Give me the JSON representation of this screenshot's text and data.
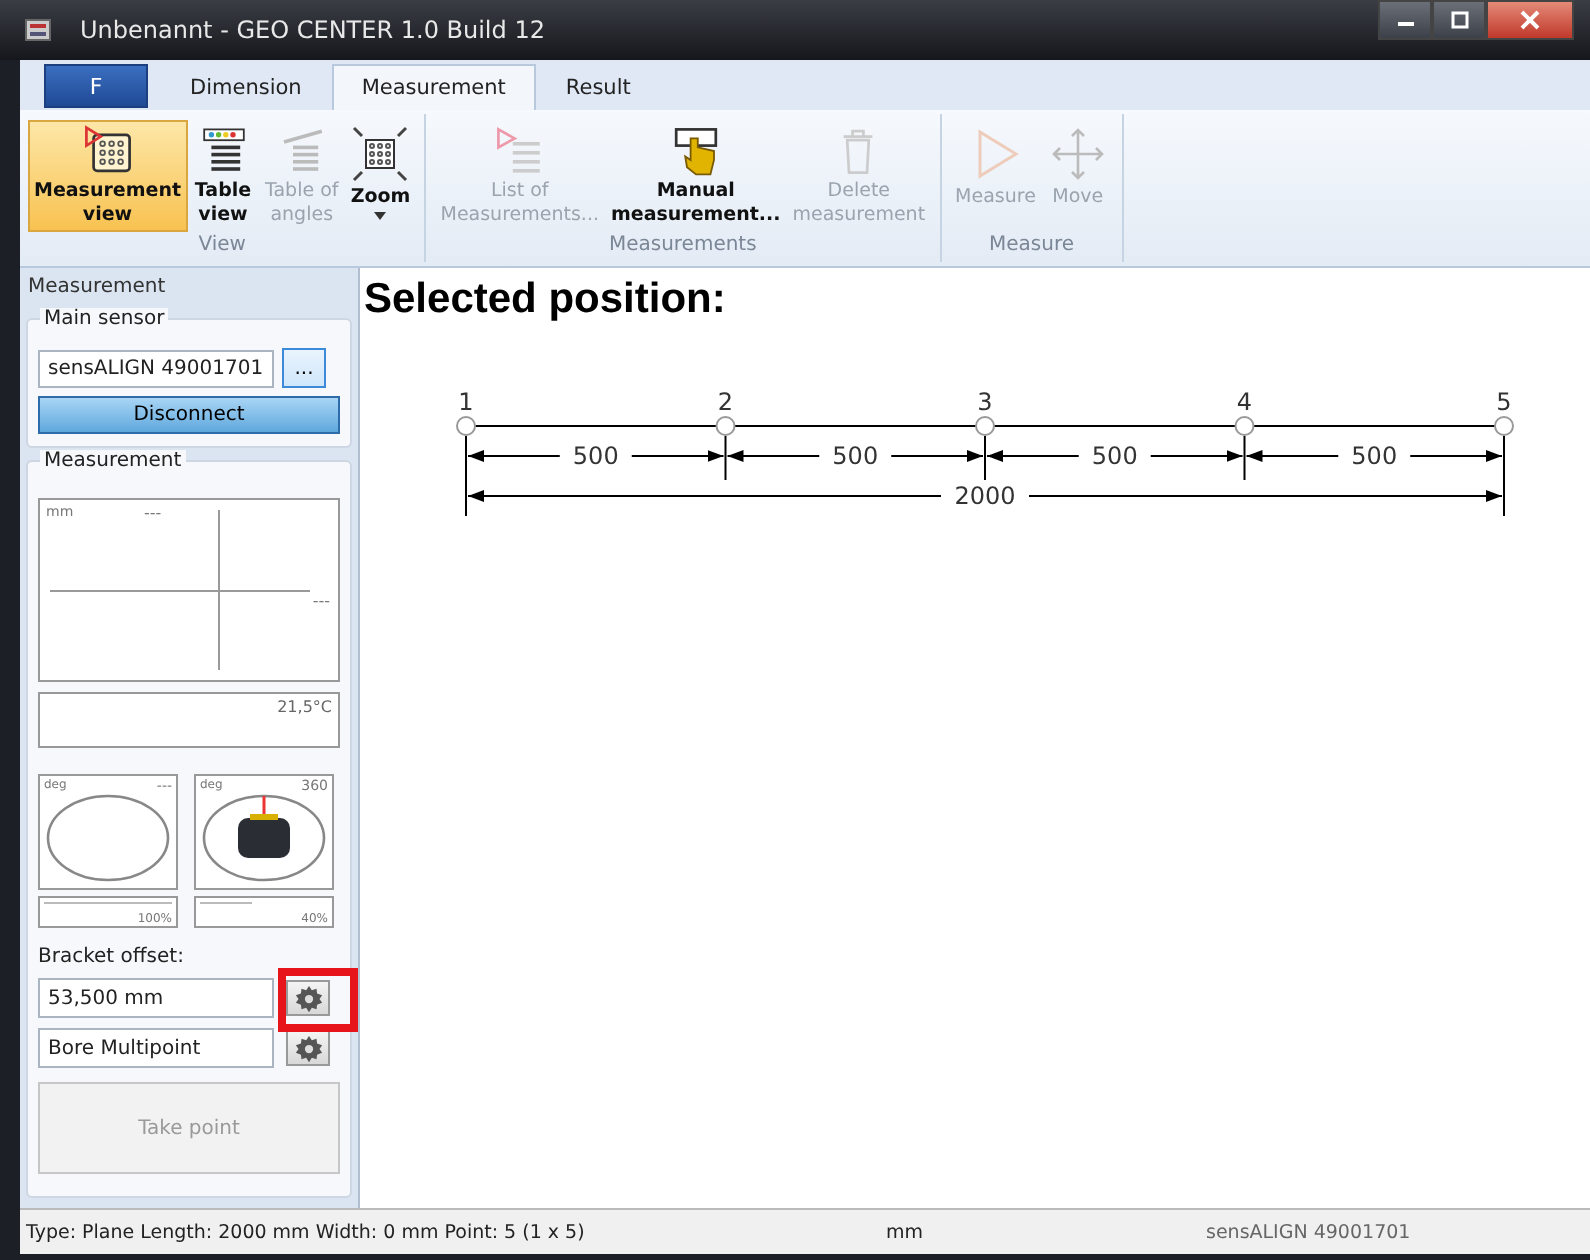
{
  "window": {
    "title": "Unbenannt - GEO CENTER 1.0 Build 12"
  },
  "app_button": {
    "label": "F"
  },
  "tabs": [
    {
      "label": "Dimension",
      "selected": false
    },
    {
      "label": "Measurement",
      "selected": true
    },
    {
      "label": "Result",
      "selected": false
    }
  ],
  "ribbon_groups": [
    {
      "label": "View",
      "buttons": [
        {
          "lines": [
            "Measurement",
            "view"
          ],
          "selected": true,
          "disabled": false
        },
        {
          "lines": [
            "Table",
            "view"
          ],
          "selected": false,
          "disabled": false
        },
        {
          "lines": [
            "Table of",
            "angles"
          ],
          "selected": false,
          "disabled": true
        },
        {
          "lines": [
            "Zoom"
          ],
          "dropdown": true,
          "selected": false,
          "disabled": false
        }
      ]
    },
    {
      "label": "Measurements",
      "buttons": [
        {
          "lines": [
            "List of",
            "Measurements..."
          ],
          "selected": false,
          "disabled": true
        },
        {
          "lines": [
            "Manual",
            "measurement..."
          ],
          "selected": false,
          "disabled": false
        },
        {
          "lines": [
            "Delete",
            "measurement"
          ],
          "selected": false,
          "disabled": true
        }
      ]
    },
    {
      "label": "Measure",
      "buttons": [
        {
          "lines": [
            "Measure"
          ],
          "selected": false,
          "disabled": true
        },
        {
          "lines": [
            "Move"
          ],
          "selected": false,
          "disabled": true
        }
      ]
    }
  ],
  "sidebar": {
    "title": "Measurement",
    "main_sensor": {
      "legend": "Main sensor",
      "value": "sensALIGN 49001701",
      "browse": "...",
      "button": "Disconnect"
    },
    "measurement": {
      "legend": "Measurement",
      "plot": {
        "unit": "mm",
        "reading_1": "---",
        "reading_2": "---"
      },
      "temperature": "21,5°C",
      "gauges": [
        {
          "kind": "empty",
          "unit": "deg",
          "reading": "---",
          "level": 1.0,
          "level_text": "100%"
        },
        {
          "kind": "sensor",
          "unit": "deg",
          "reading": "360",
          "level": 0.4,
          "level_text": "40%"
        }
      ],
      "bracket_label": "Bracket offset:",
      "fields": [
        {
          "value": "53,500 mm",
          "highlighted": true
        },
        {
          "value": "Bore Multipoint",
          "highlighted": false
        }
      ],
      "take_point": {
        "label": "Take point",
        "disabled": true
      }
    }
  },
  "content": {
    "heading": "Selected position:",
    "points": [
      "1",
      "2",
      "3",
      "4",
      "5"
    ],
    "segments": [
      "500",
      "500",
      "500",
      "500"
    ],
    "total": "2000"
  },
  "status_bar": {
    "info": "Type: Plane Length: 2000 mm Width: 0 mm Point: 5 (1 x 5)",
    "unit": "mm",
    "sensor": "sensALIGN 49001701"
  }
}
